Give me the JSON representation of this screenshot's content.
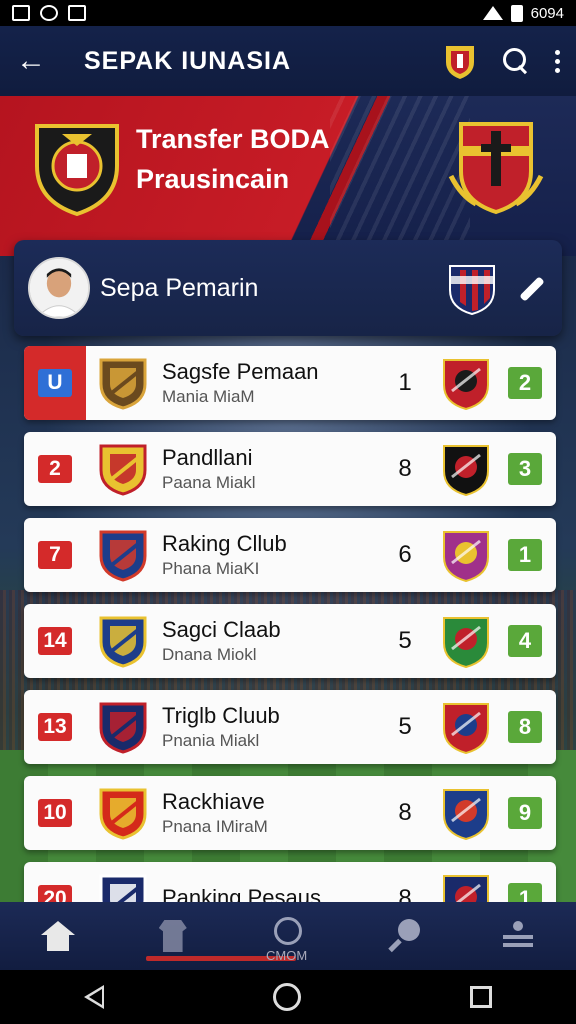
{
  "status_bar": {
    "time": "6094"
  },
  "app_bar": {
    "title": "SEPAK IUNASIA"
  },
  "banner": {
    "line1": "Transfer BODA",
    "line2": "Prausincain"
  },
  "player_card": {
    "name": "Sepa Pemarin"
  },
  "rows": [
    {
      "rank": "U",
      "name": "Sagsfe Pemaan",
      "sub": "Mania MiaM",
      "score": "1",
      "points": "2",
      "crest_colors": [
        "#6b4a1e",
        "#d9a43a"
      ],
      "opp_colors": [
        "#c0202a",
        "#1a1a1a"
      ]
    },
    {
      "rank": "2",
      "name": "Pandllani",
      "sub": "Paana Miakl",
      "score": "8",
      "points": "3",
      "crest_colors": [
        "#e9c230",
        "#c0202a"
      ],
      "opp_colors": [
        "#111111",
        "#c0202a"
      ]
    },
    {
      "rank": "7",
      "name": "Raking Cllub",
      "sub": "Phana MiaKI",
      "score": "6",
      "points": "1",
      "crest_colors": [
        "#1d3d8a",
        "#d23a2a"
      ],
      "opp_colors": [
        "#a0308a",
        "#e9c230"
      ]
    },
    {
      "rank": "14",
      "name": "Sagci Claab",
      "sub": "Dnana Miokl",
      "score": "5",
      "points": "4",
      "crest_colors": [
        "#1d3d8a",
        "#e9c230"
      ],
      "opp_colors": [
        "#2a8a3a",
        "#c0202a"
      ]
    },
    {
      "rank": "13",
      "name": "Triglb Cluub",
      "sub": "Pnania Miakl",
      "score": "5",
      "points": "8",
      "crest_colors": [
        "#1a2a6a",
        "#c0202a"
      ],
      "opp_colors": [
        "#c0202a",
        "#1d3d8a"
      ]
    },
    {
      "rank": "10",
      "name": "Rackhiave",
      "sub": "Pnana IMiraM",
      "score": "8",
      "points": "9",
      "crest_colors": [
        "#d42a1a",
        "#e9c230"
      ],
      "opp_colors": [
        "#1d3d8a",
        "#d23a2a"
      ]
    },
    {
      "rank": "20",
      "name": "Panking Pesaus",
      "sub": "",
      "score": "8",
      "points": "1",
      "crest_colors": [
        "#1a2a6a",
        "#ffffff"
      ],
      "opp_colors": [
        "#1a2a6a",
        "#c0202a"
      ]
    }
  ],
  "bottom_nav": {
    "cmom_label": "CMOM"
  },
  "icons": {
    "status": [
      "gallery-icon",
      "at-icon",
      "mute-icon",
      "wifi-icon",
      "battery-icon"
    ],
    "app_bar": [
      "back-arrow-icon",
      "club-crest-icon",
      "search-icon",
      "more-vert-icon"
    ],
    "bottom_nav": [
      "home-icon",
      "jersey-icon",
      "ball-icon",
      "racket-icon",
      "profile-icon"
    ]
  },
  "colors": {
    "primary": "#14224a",
    "accent_red": "#c71c26",
    "points_green": "#5aa83a",
    "rank_red": "#d42a2a"
  }
}
